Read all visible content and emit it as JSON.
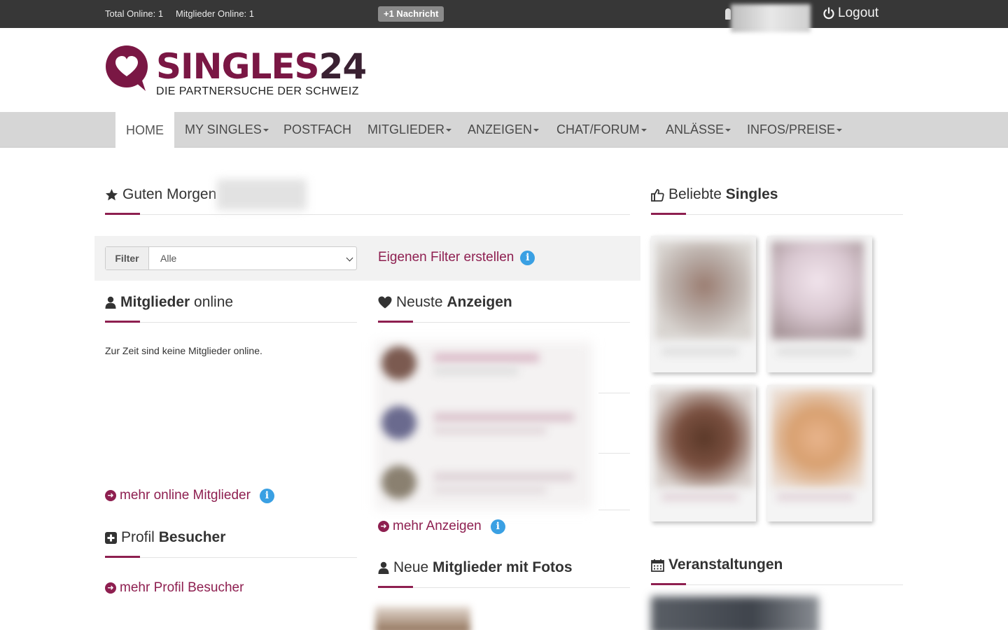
{
  "topbar": {
    "total_online": "Total Online: 1",
    "members_online": "Mitglieder Online: 1",
    "message_badge": "+1 Nachricht",
    "logout": "Logout"
  },
  "logo": {
    "brand": "SINGLES24",
    "tagline": "DIE PARTNERSUCHE DER SCHWEIZ",
    "colors": {
      "primary": "#7a1744",
      "dark": "#3a2132"
    }
  },
  "nav": {
    "items": [
      {
        "label": "HOME",
        "dropdown": false,
        "active": true
      },
      {
        "label": "MY SINGLES",
        "dropdown": true
      },
      {
        "label": "POSTFACH",
        "dropdown": false
      },
      {
        "label": "MITGLIEDER",
        "dropdown": true
      },
      {
        "label": "ANZEIGEN",
        "dropdown": true
      },
      {
        "label": "CHAT/FORUM",
        "dropdown": true
      },
      {
        "label": "ANLÄSSE",
        "dropdown": true
      },
      {
        "label": "INFOS/PREISE",
        "dropdown": true
      }
    ]
  },
  "greeting": {
    "text": "Guten Morgen",
    "icon": "star-icon"
  },
  "filter": {
    "label": "Filter",
    "selected": "Alle",
    "own_filter_link": "Eigenen Filter erstellen"
  },
  "members_online": {
    "title_bold": "Mitglieder",
    "title_rest": "online",
    "empty_text": "Zur Zeit sind keine Mitglieder online.",
    "more_link": "mehr online Mitglieder"
  },
  "newest_ads": {
    "title_rest": "Neuste",
    "title_bold": "Anzeigen",
    "more_link": "mehr Anzeigen"
  },
  "profile_visitors": {
    "title_rest": "Profil",
    "title_bold": "Besucher",
    "more_link": "mehr Profil Besucher"
  },
  "new_members": {
    "title_rest": "Neue",
    "title_bold": "Mitglieder mit Fotos"
  },
  "popular_singles": {
    "title_rest": "Beliebte",
    "title_bold": "Singles"
  },
  "events": {
    "title": "Veranstaltungen"
  },
  "colors": {
    "accent": "#8e1f50",
    "info": "#3aa0e3",
    "topbar": "#373737",
    "nav": "#d6d6d6"
  }
}
